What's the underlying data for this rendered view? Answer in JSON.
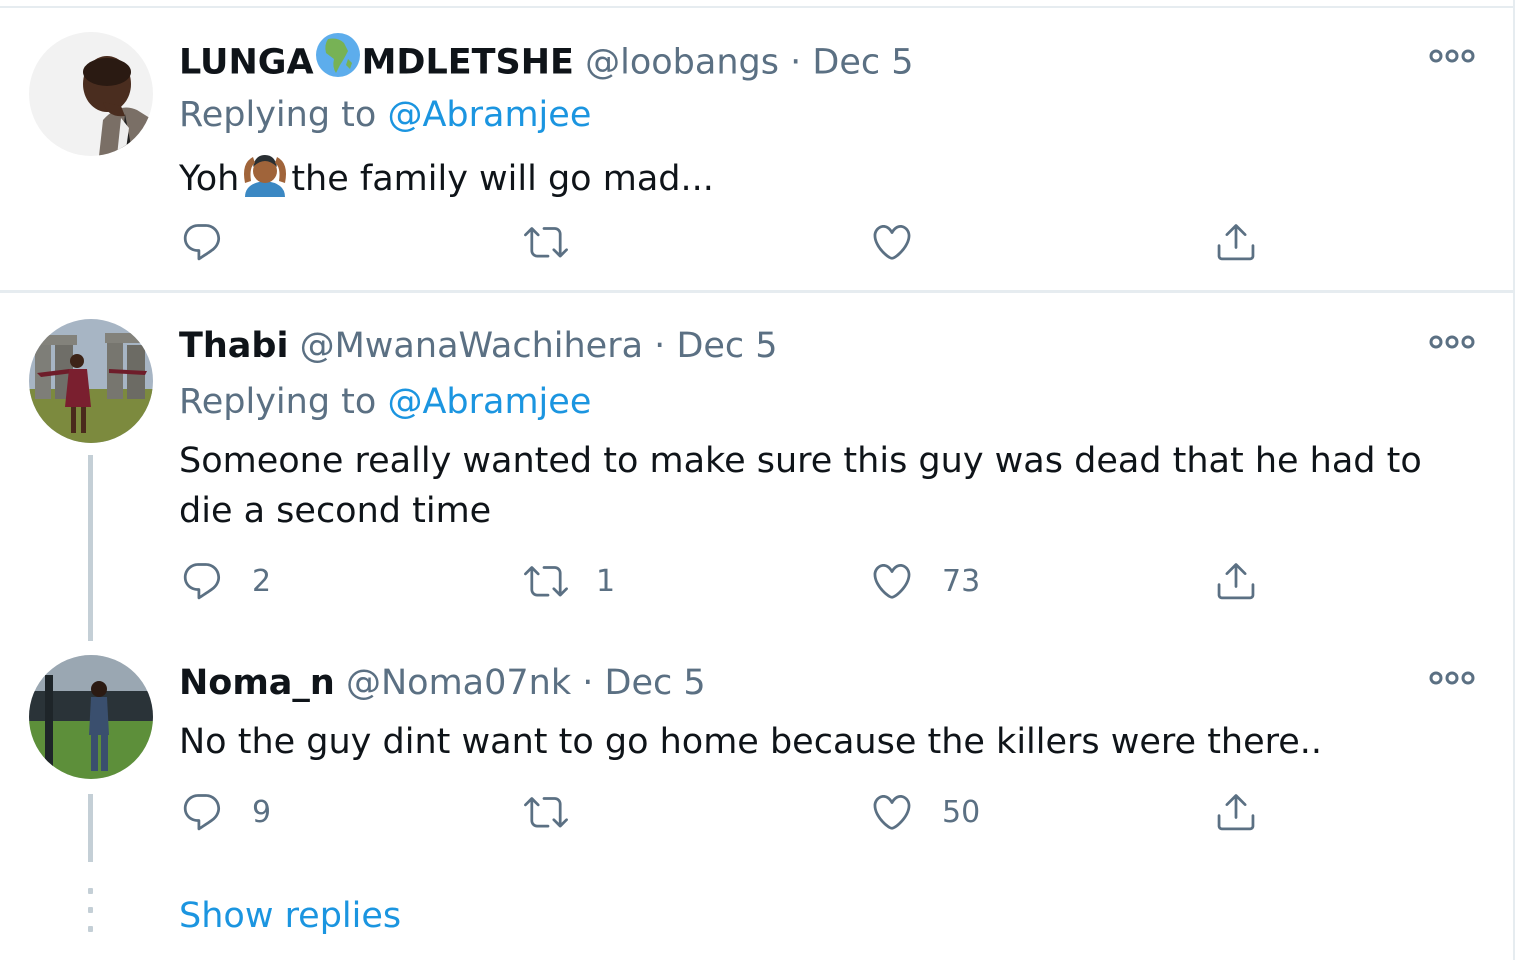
{
  "tweets": [
    {
      "name_part1": "LUNGA",
      "name_emoji": "globe-africa-emoji",
      "name_part2": "MDLETSHE",
      "handle": "@loobangs",
      "separator": "·",
      "date": "Dec 5",
      "replying_prefix": "Replying to",
      "replying_to": "@Abramjee",
      "text_before_emoji": "Yoh",
      "text_emoji": "person-gesturing-ok-emoji",
      "text_after_emoji": "the family will go mad...",
      "replies": "",
      "retweets": "",
      "likes": ""
    },
    {
      "name": "Thabi",
      "handle": "@MwanaWachihera",
      "separator": "·",
      "date": "Dec 5",
      "replying_prefix": "Replying to",
      "replying_to": "@Abramjee",
      "text": "Someone really wanted to make sure this guy was dead that he had to die a second time",
      "replies": "2",
      "retweets": "1",
      "likes": "73"
    },
    {
      "name": "Noma_n",
      "handle": "@Noma07nk",
      "separator": "·",
      "date": "Dec 5",
      "text": "No the guy dint want to go home because the killers were there..",
      "replies": "9",
      "retweets": "",
      "likes": "50"
    }
  ],
  "show_replies": "Show replies",
  "icons": {
    "reply": "reply-icon",
    "retweet": "retweet-icon",
    "like": "heart-icon",
    "share": "share-icon",
    "more": "more-icon"
  },
  "colors": {
    "link": "#1b95e0",
    "muted": "#5b7083",
    "text": "#0f1419",
    "divider": "#e6ecf0",
    "thread": "#c4cfd6"
  }
}
